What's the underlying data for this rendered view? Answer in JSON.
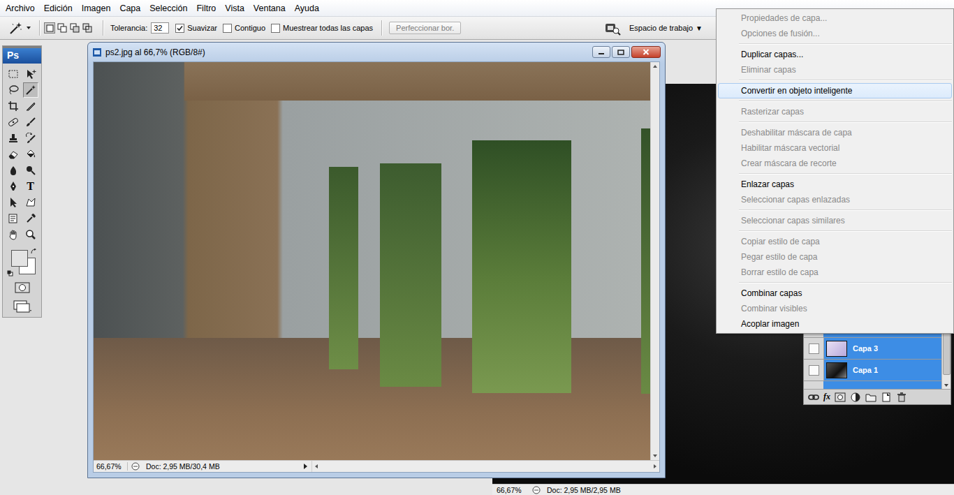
{
  "menu_bar": {
    "items": [
      "Archivo",
      "Edición",
      "Imagen",
      "Capa",
      "Selección",
      "Filtro",
      "Vista",
      "Ventana",
      "Ayuda"
    ]
  },
  "options_bar": {
    "selection_modes": [
      {
        "kind": "new",
        "selected": true
      },
      {
        "kind": "add",
        "selected": false
      },
      {
        "kind": "subtract",
        "selected": false
      },
      {
        "kind": "intersect",
        "selected": false
      }
    ],
    "tolerance": {
      "label": "Tolerancia:",
      "value": "32"
    },
    "checkboxes": [
      {
        "label": "Suavizar",
        "checked": true
      },
      {
        "label": "Contiguo",
        "checked": false
      },
      {
        "label": "Muestrear todas las capas",
        "checked": false
      }
    ],
    "refine_button": {
      "label": "Perfeccionar bor.",
      "disabled": true
    },
    "workspace": {
      "label": "Espacio de trabajo",
      "arrow": "▼"
    }
  },
  "tools_panel": {
    "logo": "Ps",
    "tools": [
      {
        "kind": "marquee",
        "selected": false
      },
      {
        "kind": "move",
        "selected": false
      },
      {
        "kind": "lasso",
        "selected": false
      },
      {
        "kind": "magic-wand",
        "selected": true
      },
      {
        "kind": "crop",
        "selected": false
      },
      {
        "kind": "slice",
        "selected": false
      },
      {
        "kind": "spot-heal",
        "selected": false
      },
      {
        "kind": "brush",
        "selected": false
      },
      {
        "kind": "stamp",
        "selected": false
      },
      {
        "kind": "history-brush",
        "selected": false
      },
      {
        "kind": "eraser",
        "selected": false
      },
      {
        "kind": "bucket",
        "selected": false
      },
      {
        "kind": "blur",
        "selected": false
      },
      {
        "kind": "dodge",
        "selected": false
      },
      {
        "kind": "pen",
        "selected": false
      },
      {
        "kind": "type",
        "selected": false,
        "glyph": "T"
      },
      {
        "kind": "path-select",
        "selected": false
      },
      {
        "kind": "shape",
        "selected": false
      },
      {
        "kind": "notes",
        "selected": false
      },
      {
        "kind": "eyedropper",
        "selected": false
      },
      {
        "kind": "hand",
        "selected": false
      },
      {
        "kind": "zoom",
        "selected": false
      }
    ],
    "swatches": [
      {
        "kind": "foreground",
        "color": "#e3e3e3"
      },
      {
        "kind": "background",
        "color": "#ffffff"
      }
    ]
  },
  "document_window": {
    "title": "ps2.jpg al 66,7% (RGB/8#)",
    "status_bar": {
      "zoom": "66,67%",
      "info": "Doc: 2,95 MB/30,4 MB"
    }
  },
  "background_window": {
    "status_bar": {
      "zoom": "66,67%",
      "info": "Doc: 2,95 MB/2,95 MB"
    }
  },
  "layers_panel": {
    "layers": [
      {
        "name": "Capa 3",
        "selected": true,
        "visible": false
      },
      {
        "name": "Capa 1",
        "selected": true,
        "visible": false
      }
    ],
    "styles_button": "fx"
  },
  "context_menu": {
    "groups": [
      {
        "items": [
          {
            "label": "Propiedades de capa...",
            "disabled": true,
            "selected": false
          },
          {
            "label": "Opciones de fusión...",
            "disabled": true,
            "selected": false
          }
        ]
      },
      {
        "items": [
          {
            "label": "Duplicar capas...",
            "disabled": false,
            "selected": false
          },
          {
            "label": "Eliminar capas",
            "disabled": true,
            "selected": false
          }
        ]
      },
      {
        "items": [
          {
            "label": "Convertir en objeto inteligente",
            "disabled": false,
            "selected": true
          }
        ]
      },
      {
        "items": [
          {
            "label": "Rasterizar capas",
            "disabled": true,
            "selected": false
          }
        ]
      },
      {
        "items": [
          {
            "label": "Deshabilitar máscara de capa",
            "disabled": true,
            "selected": false
          },
          {
            "label": "Habilitar máscara vectorial",
            "disabled": true,
            "selected": false
          },
          {
            "label": "Crear máscara de recorte",
            "disabled": true,
            "selected": false
          }
        ]
      },
      {
        "items": [
          {
            "label": "Enlazar capas",
            "disabled": false,
            "selected": false
          },
          {
            "label": "Seleccionar capas enlazadas",
            "disabled": true,
            "selected": false
          }
        ]
      },
      {
        "items": [
          {
            "label": "Seleccionar capas similares",
            "disabled": true,
            "selected": false
          }
        ]
      },
      {
        "items": [
          {
            "label": "Copiar estilo de capa",
            "disabled": true,
            "selected": false
          },
          {
            "label": "Pegar estilo de capa",
            "disabled": true,
            "selected": false
          },
          {
            "label": "Borrar estilo de capa",
            "disabled": true,
            "selected": false
          }
        ]
      },
      {
        "items": [
          {
            "label": "Combinar capas",
            "disabled": false,
            "selected": false
          },
          {
            "label": "Combinar visibles",
            "disabled": true,
            "selected": false
          },
          {
            "label": "Acoplar imagen",
            "disabled": false,
            "selected": false
          }
        ]
      }
    ]
  }
}
